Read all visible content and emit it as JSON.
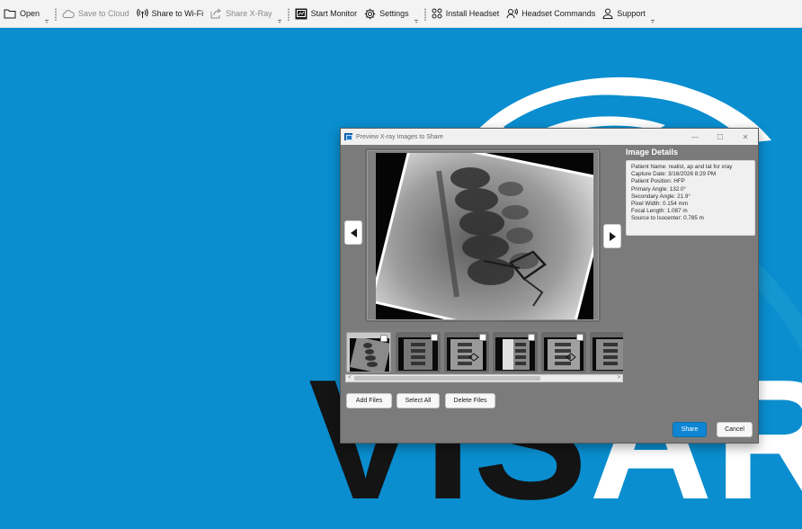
{
  "toolbar": {
    "open": "Open",
    "save_to_cloud": "Save to Cloud",
    "share_wifi": "Share to Wi-Fi",
    "share_xray": "Share X-Ray",
    "start_monitor": "Start Monitor",
    "settings": "Settings",
    "install_headset": "Install Headset",
    "headset_commands": "Headset Commands",
    "support": "Support"
  },
  "background": {
    "logo_text_dark": "VIS",
    "logo_text_light": "AR"
  },
  "dialog": {
    "title": "Preview X-ray Images to Share",
    "details_heading": "Image Details",
    "details": [
      "Patient Name: realist, ap and lat for xray",
      "Capture Date: 3/16/2026 8:29 PM",
      "Patient Position: HFP",
      "Primary Angle: 132.0°",
      "Secondary Angle: 21.9°",
      "Pixel Width: 0.154 mm",
      "Focal Length: 1.087 m",
      "Source to Isocenter: 0.785 m"
    ],
    "buttons": {
      "add_files": "Add Files",
      "select_all": "Select All",
      "delete_files": "Delete Files",
      "share": "Share",
      "cancel": "Cancel"
    },
    "window_controls": {
      "minimize": "—",
      "maximize": "☐",
      "close": "✕"
    },
    "scroll": {
      "left": "<",
      "right": ">"
    }
  },
  "colors": {
    "background_blue": "#0a8ed0",
    "share_button": "#0e86d4",
    "dialog_body": "#7b7b7b"
  }
}
